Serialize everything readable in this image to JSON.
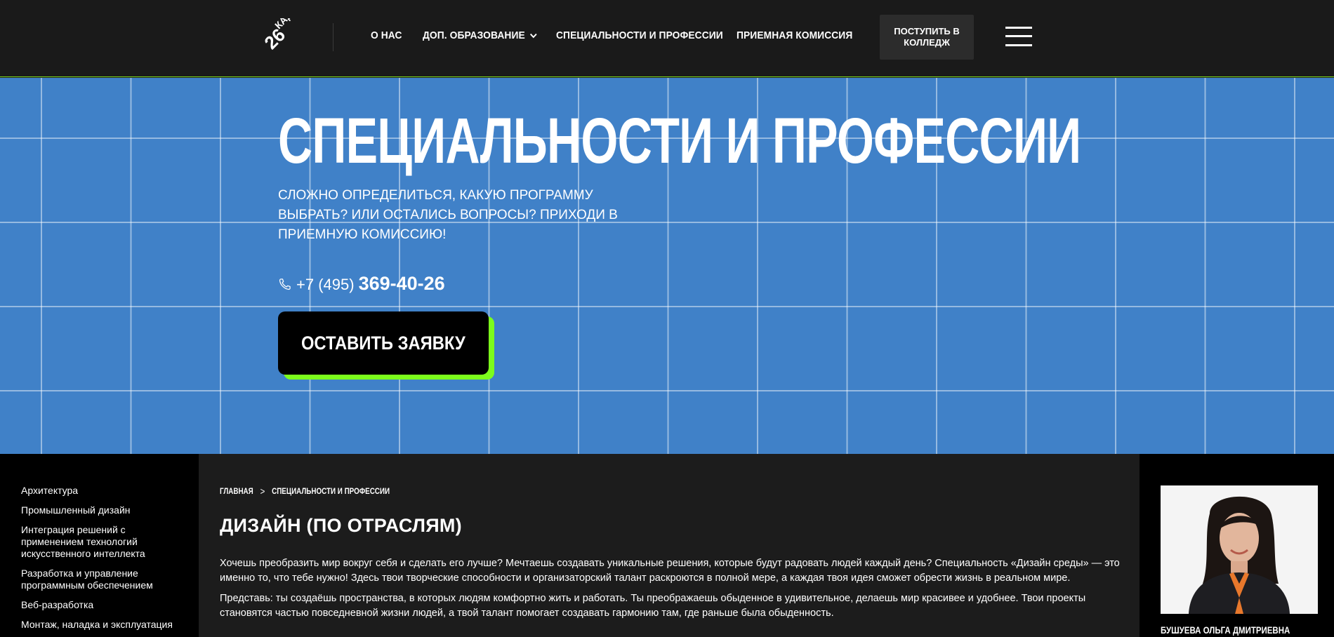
{
  "header": {
    "logo_text": "26 КАДР",
    "nav": [
      {
        "label": "О НАС"
      },
      {
        "label": "ДОП. ОБРАЗОВАНИЕ",
        "has_dropdown": true
      },
      {
        "label": "СПЕЦИАЛЬНОСТИ И ПРОФЕССИИ"
      },
      {
        "label": "ПРИЕМНАЯ КОМИССИЯ"
      }
    ],
    "apply_button": "ПОСТУПИТЬ В КОЛЛЕДЖ",
    "menu_icon": "hamburger-icon"
  },
  "hero": {
    "title": "СПЕЦИАЛЬНОСТИ И ПРОФЕССИИ",
    "subtitle": "СЛОЖНО ОПРЕДЕЛИТЬСЯ, КАКУЮ ПРОГРАММУ ВЫБРАТЬ? ИЛИ ОСТАЛИСЬ ВОПРОСЫ? ПРИХОДИ В ПРИЕМНУЮ КОМИССИЮ!",
    "phone_prefix": "+7 (495)",
    "phone_number": "369-40-26",
    "cta": "ОСТАВИТЬ ЗАЯВКУ",
    "background_color": "#4081c8",
    "accent_color": "#7cfc1c"
  },
  "sidebar": {
    "items": [
      {
        "label": "Архитектура"
      },
      {
        "label": "Промышленный дизайн"
      },
      {
        "label": "Интеграция решений с применением технологий искусственного интеллекта"
      },
      {
        "label": "Разработка и управление программным обеспечением"
      },
      {
        "label": "Веб-разработка"
      },
      {
        "label": "Монтаж, наладка и эксплуатация"
      }
    ]
  },
  "main": {
    "breadcrumb": [
      {
        "label": "ГЛАВНАЯ"
      },
      {
        "label": "СПЕЦИАЛЬНОСТИ И ПРОФЕССИИ"
      }
    ],
    "breadcrumb_separator": ">",
    "title": "ДИЗАЙН (ПО ОТРАСЛЯМ)",
    "paragraph_1": "Хочешь преобразить мир вокруг себя и сделать его лучше? Мечтаешь создавать уникальные решения, которые будут радовать людей каждый день? Специальность «Дизайн среды» — это именно то, что тебе нужно! Здесь твои творческие способности и организаторский талант раскроются в полной мере, а каждая твоя идея сможет обрести жизнь в реальном мире.",
    "paragraph_2": "Представь: ты создаёшь пространства, в которых людям комфортно жить и работать. Ты преображаешь обыденное в удивительное, делаешь мир красивее и удобнее. Твои проекты становятся частью повседневной жизни людей, а твой талант помогает создавать гармонию там, где раньше была обыденность."
  },
  "contact_person": {
    "name": "БУШУЕВА ОЛЬГА ДМИТРИЕВНА"
  }
}
